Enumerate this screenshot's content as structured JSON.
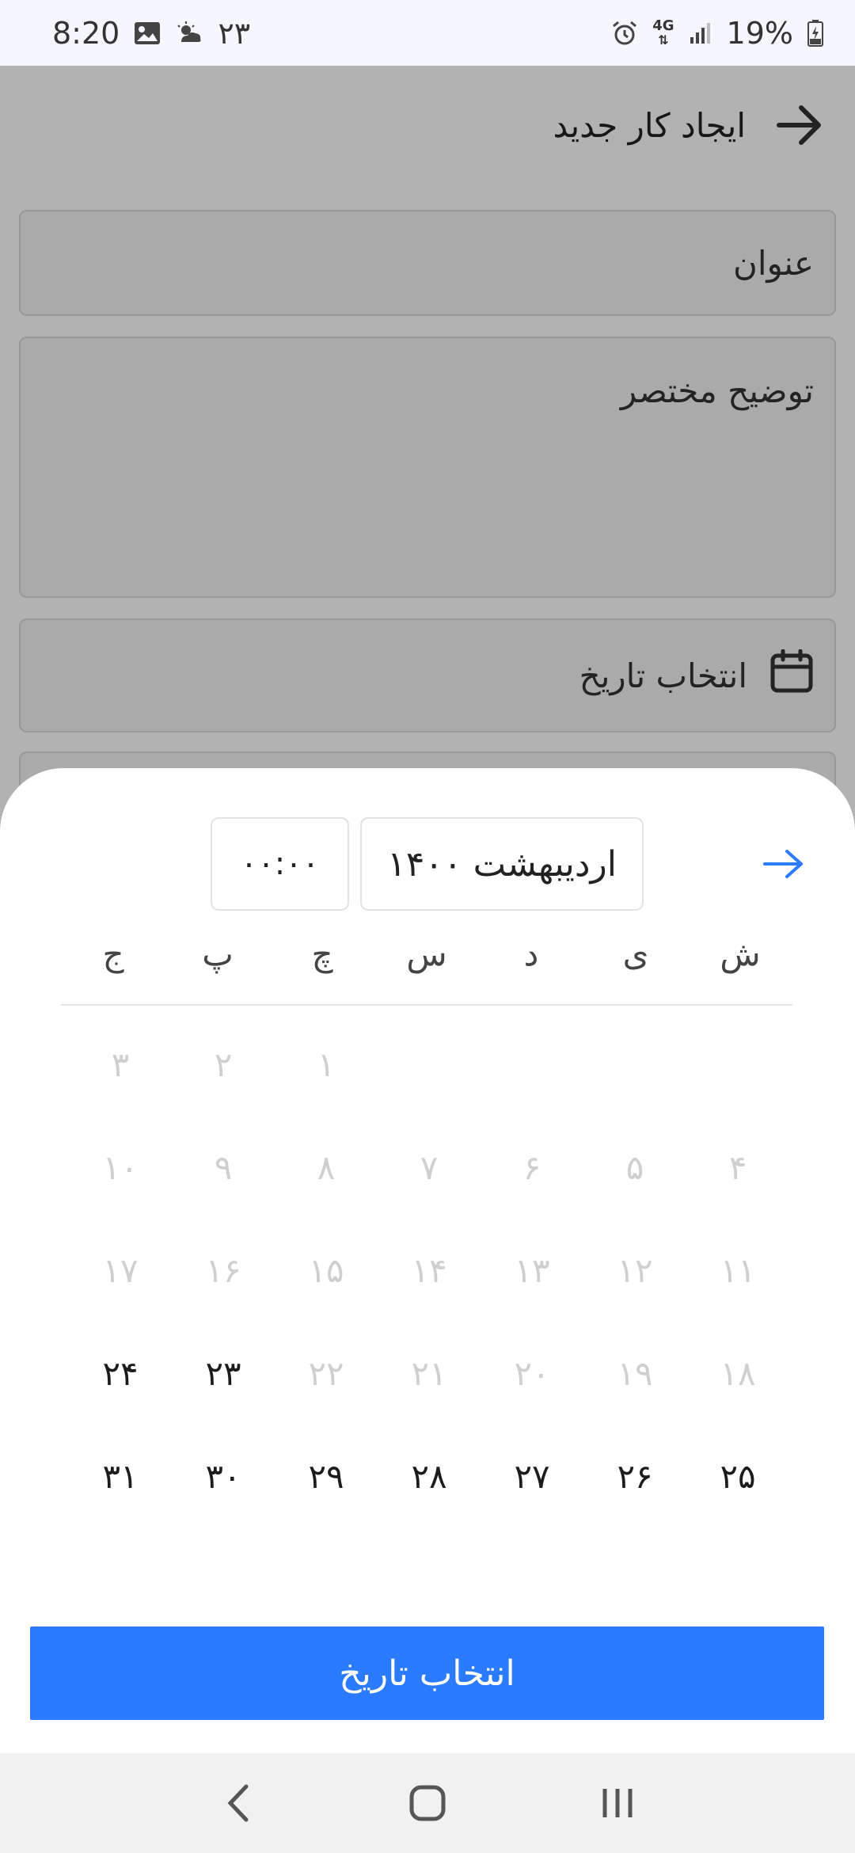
{
  "status_bar": {
    "time": "8:20",
    "weather_temp": "۲۳",
    "network": "4G",
    "battery": "19%",
    "icons": [
      "gallery-icon",
      "weather-icon",
      "alarm-icon",
      "signal-icon",
      "battery-icon"
    ]
  },
  "appbar": {
    "title": "ایجاد کار جدید",
    "back_icon": "arrow-right-icon"
  },
  "form": {
    "title_placeholder": "عنوان",
    "description_placeholder": "توضیح مختصر",
    "date_placeholder": "انتخاب تاریخ",
    "date_icon": "calendar-icon"
  },
  "picker": {
    "month_label": "اردیبهشت ۱۴۰۰",
    "time_label": "۰۰:۰۰",
    "nav_icon": "arrow-right-icon",
    "weekdays": [
      "ش",
      "ی",
      "د",
      "س",
      "چ",
      "پ",
      "ج"
    ],
    "weeks": [
      [
        {
          "d": "",
          "s": "blank"
        },
        {
          "d": "",
          "s": "blank"
        },
        {
          "d": "",
          "s": "blank"
        },
        {
          "d": "",
          "s": "blank"
        },
        {
          "d": "۱",
          "s": "disabled"
        },
        {
          "d": "۲",
          "s": "disabled"
        },
        {
          "d": "۳",
          "s": "disabled"
        }
      ],
      [
        {
          "d": "۴",
          "s": "disabled"
        },
        {
          "d": "۵",
          "s": "disabled"
        },
        {
          "d": "۶",
          "s": "disabled"
        },
        {
          "d": "۷",
          "s": "disabled"
        },
        {
          "d": "۸",
          "s": "disabled"
        },
        {
          "d": "۹",
          "s": "disabled"
        },
        {
          "d": "۱۰",
          "s": "disabled"
        }
      ],
      [
        {
          "d": "۱۱",
          "s": "disabled"
        },
        {
          "d": "۱۲",
          "s": "disabled"
        },
        {
          "d": "۱۳",
          "s": "disabled"
        },
        {
          "d": "۱۴",
          "s": "disabled"
        },
        {
          "d": "۱۵",
          "s": "disabled"
        },
        {
          "d": "۱۶",
          "s": "disabled"
        },
        {
          "d": "۱۷",
          "s": "disabled"
        }
      ],
      [
        {
          "d": "۱۸",
          "s": "disabled"
        },
        {
          "d": "۱۹",
          "s": "disabled"
        },
        {
          "d": "۲۰",
          "s": "disabled"
        },
        {
          "d": "۲۱",
          "s": "disabled"
        },
        {
          "d": "۲۲",
          "s": "disabled"
        },
        {
          "d": "۲۳",
          "s": "enabled"
        },
        {
          "d": "۲۴",
          "s": "enabled"
        }
      ],
      [
        {
          "d": "۲۵",
          "s": "enabled"
        },
        {
          "d": "۲۶",
          "s": "enabled"
        },
        {
          "d": "۲۷",
          "s": "enabled"
        },
        {
          "d": "۲۸",
          "s": "enabled"
        },
        {
          "d": "۲۹",
          "s": "enabled"
        },
        {
          "d": "۳۰",
          "s": "enabled"
        },
        {
          "d": "۳۱",
          "s": "enabled"
        }
      ]
    ],
    "confirm_label": "انتخاب تاریخ"
  },
  "colors": {
    "accent": "#2a7bff",
    "disabled_day": "#cfcfcf",
    "enabled_day": "#1c1c1c"
  },
  "navbar": {
    "icons": [
      "back-nav-icon",
      "home-nav-icon",
      "recents-nav-icon"
    ]
  }
}
